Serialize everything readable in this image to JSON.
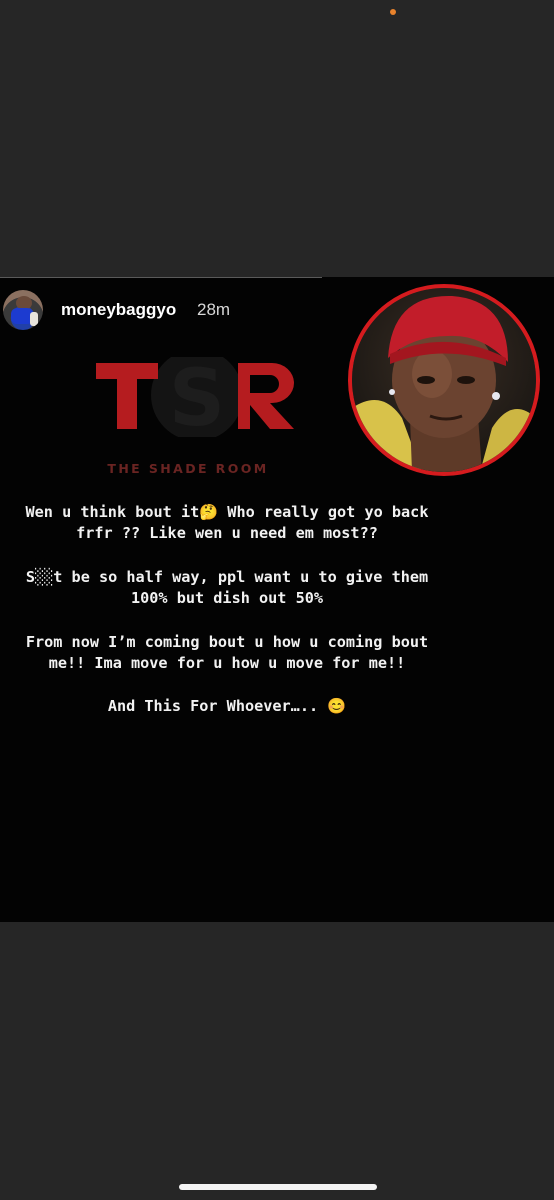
{
  "status_bar": {
    "indicator_color": "#e8822c"
  },
  "story": {
    "username": "moneybaggyo",
    "timestamp": "28m",
    "avatar_icon": "profile-avatar",
    "logo": {
      "letters": "TSR",
      "tagline": "THE SHADE ROOM",
      "letter_color": "#b51c1f"
    },
    "selfie_ring_color": "#d51b1e",
    "caption": [
      "Wen u think bout it🤔 Who really got yo back frfr ?? Like wen u need em most??",
      "S░░t be so half way, ppl want u to give them 100% but dish out 50%",
      "From now I’m coming bout u how u coming bout me!! Ima move for u how u move for me!!",
      "And This For Whoever….. 😊"
    ]
  },
  "home_indicator": {
    "color": "#f4f4f4"
  }
}
